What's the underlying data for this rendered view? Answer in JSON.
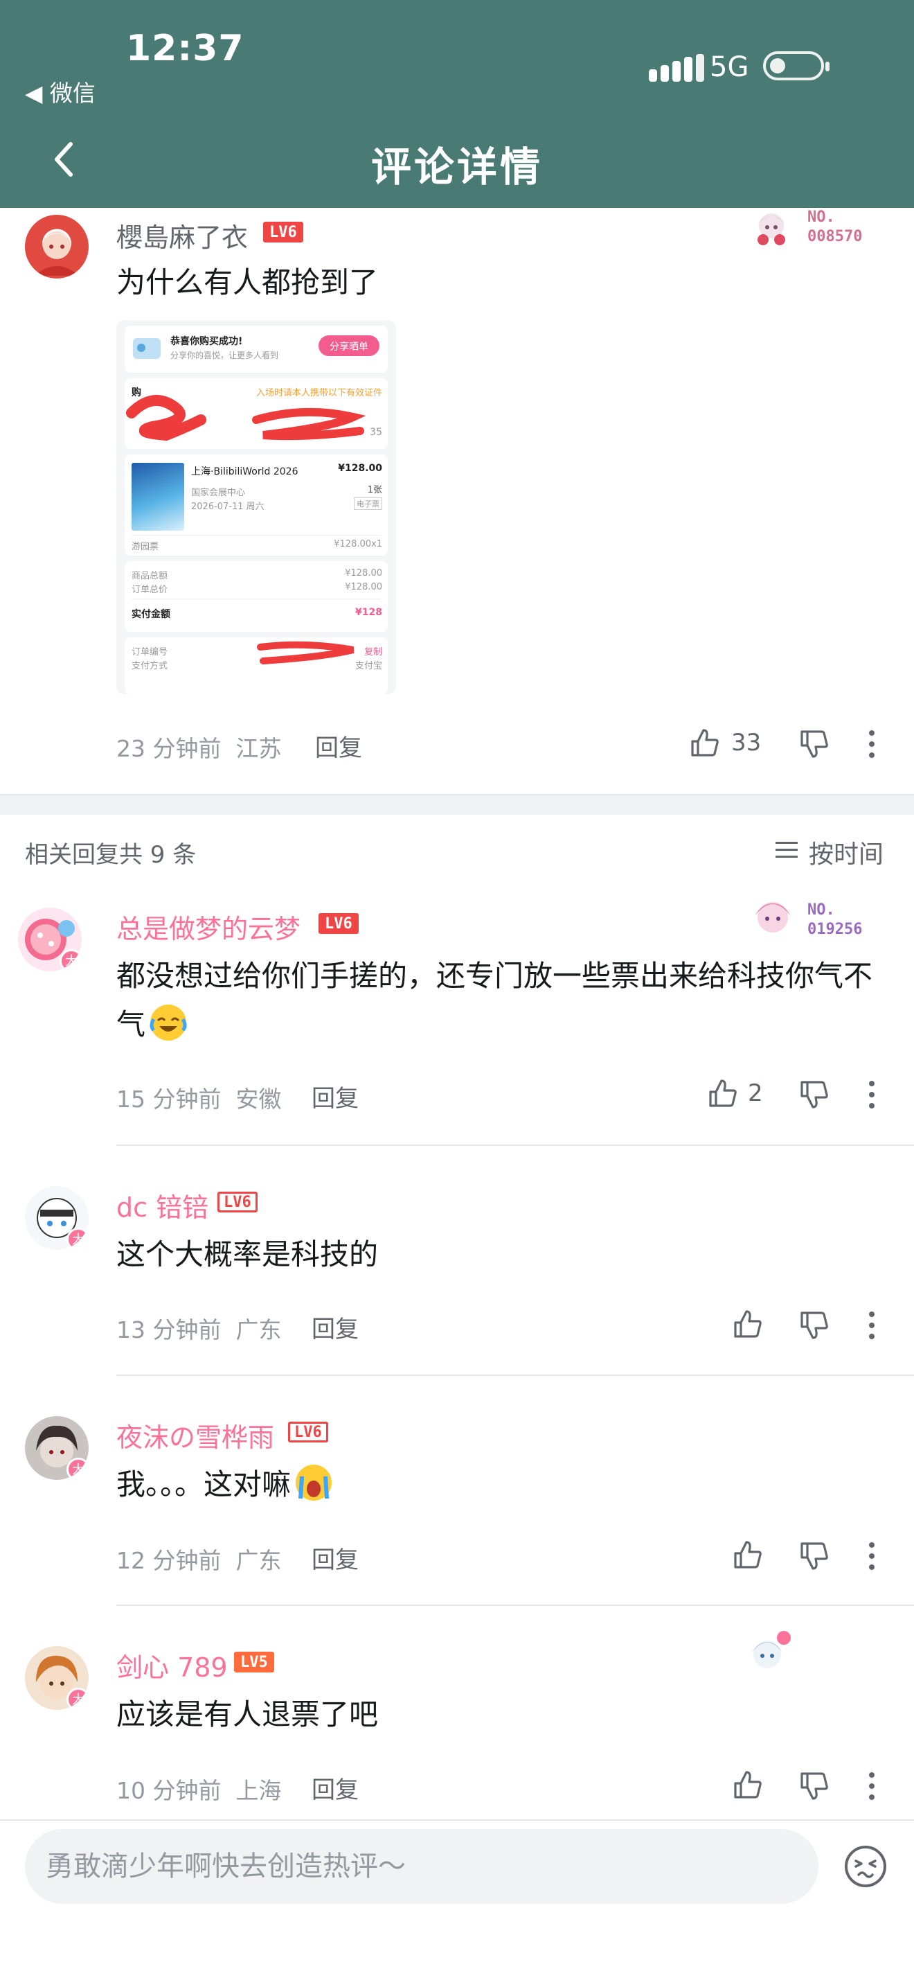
{
  "status_bar": {
    "time": "12:37",
    "back_app": "◀ 微信",
    "network": "5G"
  },
  "nav": {
    "title": "评论详情"
  },
  "main_comment": {
    "username": "櫻島麻了衣",
    "level": "LV6",
    "number_plate": "NO.\n008570",
    "text": "为什么有人都抢到了",
    "time": "23 分钟前",
    "location": "江苏",
    "reply_label": "回复",
    "likes": "33",
    "screenshot": {
      "success_title": "恭喜你购买成功!",
      "success_sub": "分享你的喜悦，让更多人看到",
      "share_button": "分享晒单",
      "buyer_label": "购",
      "notice": "入场时请本人携带以下有效证件",
      "buyer_suffix": "35",
      "event_name": "上海·BilibiliWorld 2026",
      "price": "¥128.00",
      "venue": "国家会展中心",
      "date": "2026-07-11 周六",
      "qty": "1张",
      "ticket_type": "电子票",
      "ticket_name": "游园票",
      "ticket_line": "¥128.00x1",
      "goods_total_label": "商品总额",
      "goods_total": "¥128.00",
      "order_total_label": "订单总价",
      "order_total": "¥128.00",
      "paid_label": "实付金额",
      "paid": "¥128",
      "order_no_label": "订单编号",
      "copy_label": "复制",
      "pay_method_label": "支付方式",
      "pay_method": "支付宝"
    }
  },
  "replies_header": {
    "count": "相关回复共 9 条",
    "sort": "按时间"
  },
  "replies": [
    {
      "username": "总是做梦的云梦",
      "level": "LV6",
      "number_plate": "NO.\n019256",
      "text": "都没想过给你们手搓的，还专门放一些票出来给科技你气不气",
      "time": "15 分钟前",
      "location": "安徽",
      "reply_label": "回复",
      "likes": "2"
    },
    {
      "username": "dc 锫锫",
      "level": "LV6",
      "text": "这个大概率是科技的",
      "time": "13 分钟前",
      "location": "广东",
      "reply_label": "回复",
      "likes": ""
    },
    {
      "username": "夜沫の雪桦雨",
      "level": "LV6",
      "text": "我。。。这对嘛",
      "time": "12 分钟前",
      "location": "广东",
      "reply_label": "回复",
      "likes": ""
    },
    {
      "username": "剑心 789",
      "level": "LV5",
      "text": "应该是有人退票了吧",
      "time": "10 分钟前",
      "location": "上海",
      "reply_label": "回复",
      "likes": ""
    }
  ],
  "input": {
    "placeholder": "勇敢滴少年啊快去创造热评～"
  },
  "colors": {
    "header": "#4a7a74",
    "pink": "#fb7299",
    "level_red": "#f04545",
    "meta_gray": "#9499a0"
  },
  "icons": [
    "chevron-left-icon",
    "signal-icon",
    "battery-icon",
    "thumb-up-icon",
    "thumb-down-icon",
    "more-icon",
    "sort-list-icon",
    "emoji-icon"
  ]
}
